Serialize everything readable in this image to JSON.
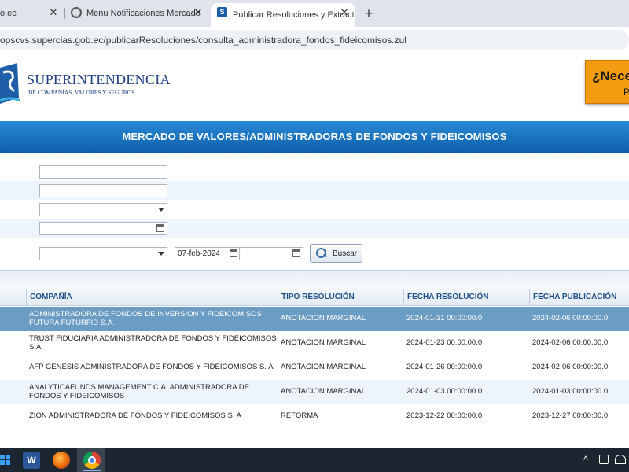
{
  "browser": {
    "tabs": [
      {
        "title": "o.ec",
        "close": "✕"
      },
      {
        "title": "Menu Notificaciones Mercado",
        "close": "✕"
      },
      {
        "title": "Publicar Resoluciones y Extracto",
        "close": "✕"
      }
    ],
    "new_tab": "+",
    "url": "opscvs.supercias.gob.ec/publicarResoluciones/consulta_administradora_fondos_fideicomisos.zul"
  },
  "header": {
    "logo_main": "SUPERINTENDENCIA",
    "logo_sub": "DE COMPAÑÍAS, VALORES Y SEGUROS",
    "promo_title": "¿Nece",
    "promo_sub": "P"
  },
  "banner": {
    "title": "MERCADO DE VALORES/ADMINISTRADORAS DE FONDOS Y FIDEICOMISOS"
  },
  "form": {
    "date_from": "07-feb-2024",
    "date_separator": ":",
    "search_label": "Buscar"
  },
  "table": {
    "headers": [
      "",
      "COMPAÑÍA",
      "TIPO RESOLUCIÓN",
      "FECHA RESOLUCIÓN",
      "FECHA PUBLICACIÓN"
    ],
    "rows": [
      {
        "company": "ADMINISTRADORA DE FONDOS DE INVERSION Y FIDEICOMISOS FUTURA FUTURFID S.A.",
        "type": "ANOTACION MARGINAL",
        "res_date": "2024-01-31 00:00:00.0",
        "pub_date": "2024-02-06 00:00:00.0"
      },
      {
        "company": "TRUST FIDUCIARIA ADMINISTRADORA DE FONDOS Y FIDEICOMISOS S.A",
        "type": "ANOTACION MARGINAL",
        "res_date": "2024-01-23 00:00:00.0",
        "pub_date": "2024-02-06 00:00:00.0"
      },
      {
        "company": "AFP GENESIS ADMINISTRADORA DE FONDOS Y FIDEICOMISOS S. A.",
        "type": "ANOTACION MARGINAL",
        "res_date": "2024-01-26 00:00:00.0",
        "pub_date": "2024-02-06 00:00:00.0"
      },
      {
        "company": "ANALYTICAFUNDS MANAGEMENT C.A. ADMINISTRADORA DE FONDOS Y FIDEICOMISOS",
        "type": "ANOTACION MARGINAL",
        "res_date": "2024-01-03 00:00:00.0",
        "pub_date": "2024-01-03 00:00:00.0"
      },
      {
        "company": "ZION ADMINISTRADORA DE FONDOS Y FIDEICOMISOS S. A",
        "type": "REFORMA",
        "res_date": "2023-12-22 00:00:00.0",
        "pub_date": "2023-12-27 00:00:00.0"
      }
    ]
  },
  "taskbar": {
    "word_letter": "W",
    "tray_chevron": "^"
  }
}
